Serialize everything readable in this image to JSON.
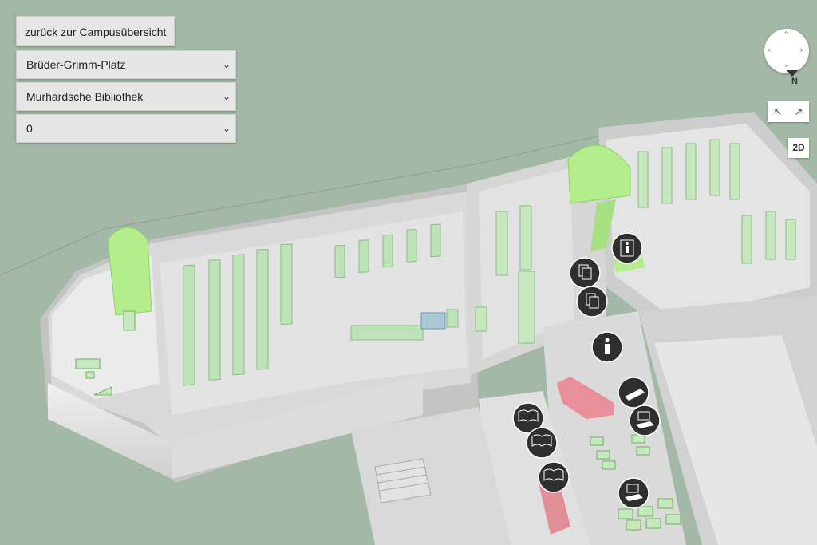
{
  "controls": {
    "back_label": "zurück zur Campusübersicht",
    "campus_select": "Brüder-Grimm-Platz",
    "building_select": "Murhardsche Bibliothek",
    "floor_select": "0"
  },
  "map_controls": {
    "north_label": "N",
    "view_2d_label": "2D",
    "rotate_left": "↖",
    "rotate_right": "↗"
  },
  "pois": [
    {
      "icon": "elevator-icon"
    },
    {
      "icon": "copier-icon"
    },
    {
      "icon": "copier-icon"
    },
    {
      "icon": "info-icon"
    },
    {
      "icon": "scanner-icon"
    },
    {
      "icon": "computer-workstation-icon"
    },
    {
      "icon": "book-return-icon"
    },
    {
      "icon": "book-loan-icon"
    },
    {
      "icon": "book-pickup-icon"
    },
    {
      "icon": "computer-workstation-icon"
    }
  ],
  "colors": {
    "background": "#a3b8a7",
    "building": "#d4d4d4",
    "shelf": "#bfe3b8",
    "stairwell": "#b4ee8c",
    "counter": "#e88f9a",
    "poi": "#2f2f2f"
  }
}
